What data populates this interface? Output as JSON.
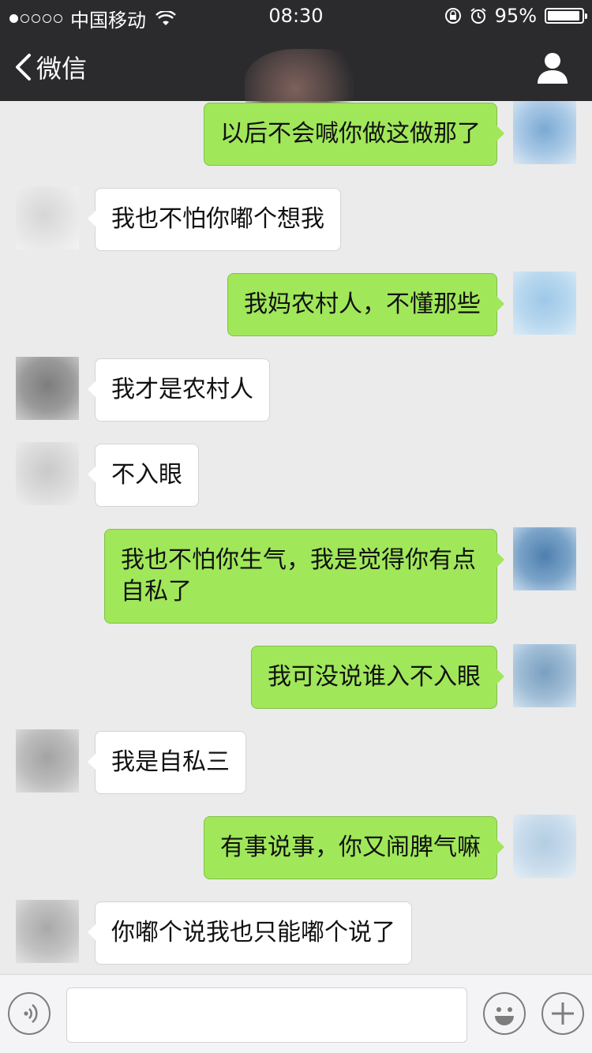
{
  "status_bar": {
    "carrier": "中国移动",
    "time": "08:30",
    "battery": "95%",
    "battery_level": 0.95
  },
  "nav": {
    "back_label": "微信",
    "back_icon": "chevron-left-icon",
    "profile_icon": "person-icon"
  },
  "messages": [
    {
      "side": "out",
      "text": "以后不会喊你做这做那了"
    },
    {
      "side": "in",
      "text": "我也不怕你嘟个想我"
    },
    {
      "side": "out",
      "text": "我妈农村人，不懂那些"
    },
    {
      "side": "in",
      "text": "我才是农村人"
    },
    {
      "side": "in",
      "text": "不入眼"
    },
    {
      "side": "out",
      "text": "我也不怕你生气，我是觉得你有点自私了"
    },
    {
      "side": "out",
      "text": "我可没说谁入不入眼"
    },
    {
      "side": "in",
      "text": "我是自私三"
    },
    {
      "side": "out",
      "text": "有事说事，你又闹脾气嘛"
    },
    {
      "side": "in",
      "text": "你嘟个说我也只能嘟个说了"
    }
  ],
  "input_bar": {
    "voice_icon": "voice-icon",
    "emoji_icon": "emoji-icon",
    "plus_icon": "plus-icon",
    "text_value": ""
  },
  "colors": {
    "nav_bg": "#2b2b2e",
    "chat_bg": "#ebebeb",
    "outgoing_bubble": "#a0e75a",
    "incoming_bubble": "#ffffff"
  }
}
